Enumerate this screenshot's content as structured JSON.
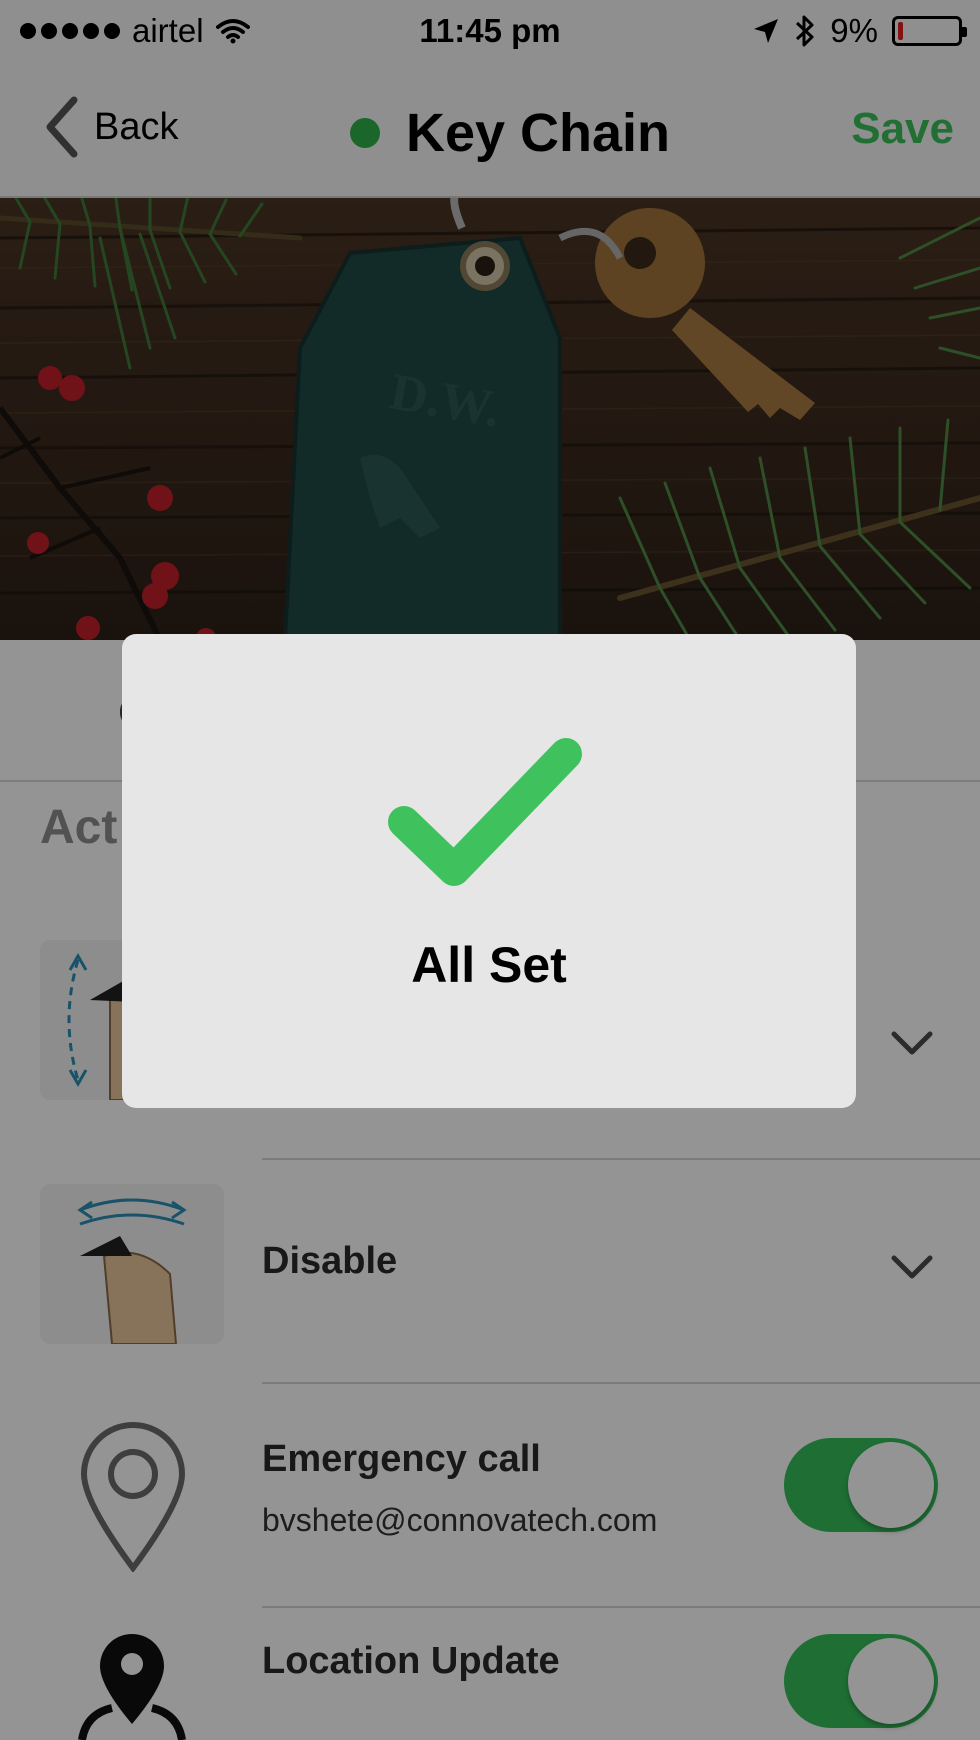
{
  "status_bar": {
    "carrier": "airtel",
    "time": "11:45 pm",
    "battery_percent": "9%",
    "battery_level": 0.09,
    "icons": [
      "signal-dots",
      "wifi-icon",
      "location-arrow-icon",
      "bluetooth-icon",
      "battery-icon"
    ]
  },
  "nav": {
    "back_label": "Back",
    "title": "Key Chain",
    "save_label": "Save",
    "status_dot_color": "#2fb24b",
    "save_color": "#3cc05a"
  },
  "content": {
    "hidden_row_label": "C",
    "section_header": "Act",
    "rows": [
      {
        "title": "",
        "icon": "shake-vertical-icon",
        "control": "chevron-down"
      },
      {
        "title": "Disable",
        "icon": "shake-horizontal-icon",
        "control": "chevron-down"
      },
      {
        "title": "Emergency call",
        "subtitle": "bvshete@connovatech.com",
        "icon": "map-pin-outline-icon",
        "control": "toggle",
        "on": true
      },
      {
        "title": "Location Update",
        "icon": "map-pin-filled-icon",
        "control": "toggle",
        "on": true
      }
    ]
  },
  "hud": {
    "icon": "checkmark-icon",
    "label": "All Set",
    "check_color": "#3fc25d"
  }
}
